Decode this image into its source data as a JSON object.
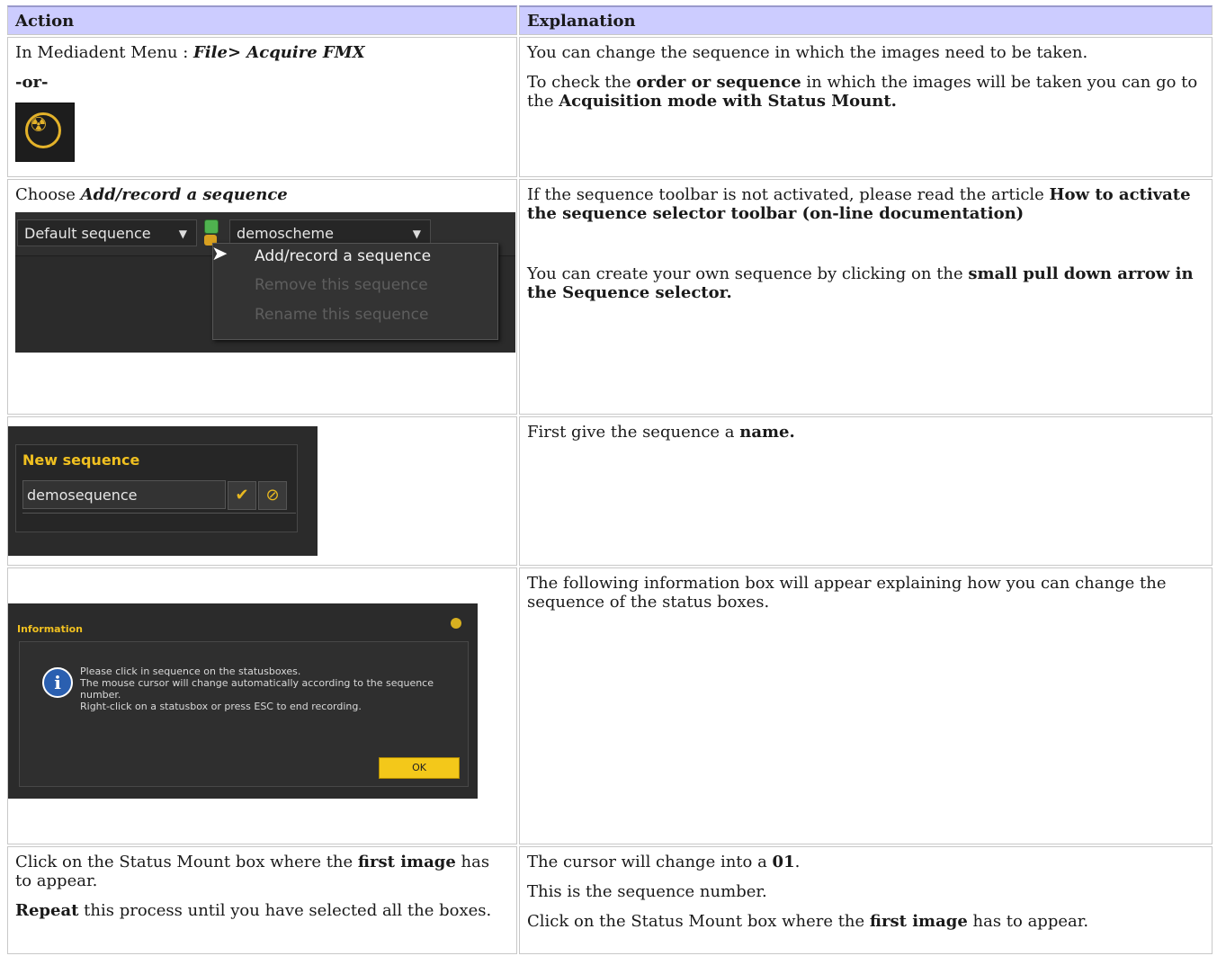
{
  "table": {
    "headers": [
      "Action",
      "Explanation"
    ]
  },
  "row1": {
    "action_prefix": "In Mediadent Menu : ",
    "action_path": "File> Acquire FMX",
    "or": "-or-",
    "expl_p1": "You can change the sequence in which the images need to be taken.",
    "expl_p2_a": "To check the ",
    "expl_p2_b": "order or sequence",
    "expl_p2_c": " in which the images will be taken you can go to the ",
    "expl_p2_d": "Acquisition mode with Status Mount."
  },
  "row2": {
    "action_prefix": "Choose ",
    "action_bold": "Add/record a sequence",
    "toolbar": {
      "sequence_combo": "Default sequence",
      "scheme_combo": "demoscheme",
      "menu_items": [
        "Add/record a sequence",
        "Remove this sequence",
        "Rename this sequence"
      ]
    },
    "expl_p1_a": "If the sequence toolbar is not activated, please read the article ",
    "expl_p1_b": "How to activate the sequence selector toolbar (on-line documentation)",
    "expl_p2_a": "You can create your own sequence by clicking on the ",
    "expl_p2_b": "small pull down arrow in the Sequence selector."
  },
  "row3": {
    "dialog_title": "New sequence",
    "dialog_value": "demosequence",
    "expl_a": "First give the sequence a ",
    "expl_b": "name."
  },
  "row4": {
    "info_title": "Information",
    "info_lines": [
      "Please click in sequence on the statusboxes.",
      "The mouse cursor will change automatically according to the sequence number.",
      "Right-click on a statusbox or press ESC to end recording."
    ],
    "ok_label": "OK",
    "expl": "The following information box will appear explaining how you can change the sequence of the status boxes."
  },
  "row5": {
    "action_p1_a": "Click on the Status Mount box where the ",
    "action_p1_b": "first image",
    "action_p1_c": " has to appear.",
    "action_p2_a": "Repeat",
    "action_p2_b": " this process until you have selected all the boxes.",
    "expl_p1_a": "The cursor will change into a ",
    "expl_p1_b": "01",
    "expl_p1_c": ".",
    "expl_p2": "This is the sequence number.",
    "expl_p3_a": "Click on the Status Mount box where the ",
    "expl_p3_b": "first image",
    "expl_p3_c": " has to appear."
  },
  "colors": {
    "header_bg": "#ccccff",
    "accent_yellow": "#f0c020"
  }
}
